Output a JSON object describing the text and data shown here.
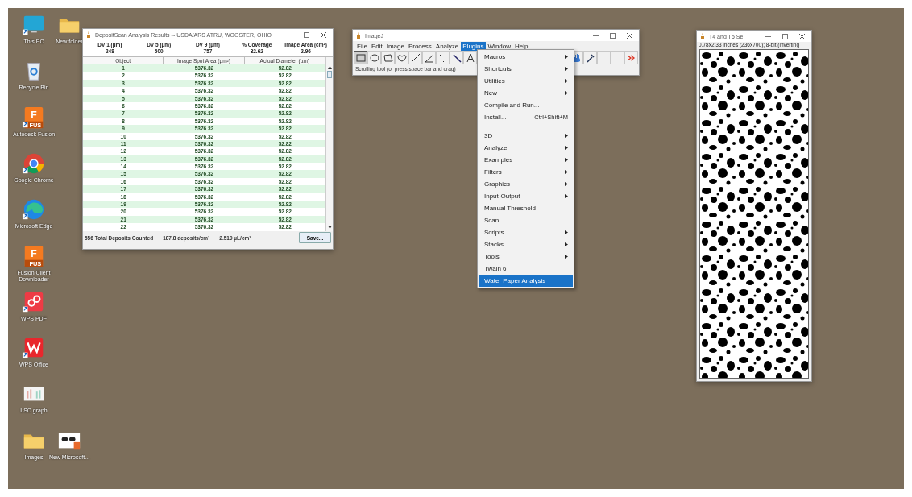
{
  "desktop_icons": [
    {
      "label": "This PC",
      "kind": "monitor",
      "shortcut": true
    },
    {
      "label": "New folder",
      "kind": "folder",
      "shortcut": false
    },
    {
      "label": "Recycle Bin",
      "kind": "recycle-bin",
      "shortcut": false
    },
    {
      "label": "Autodesk Fusion",
      "kind": "fusion",
      "glyph": "F",
      "badge": "FUS",
      "shortcut": true
    },
    {
      "label": "Google Chrome",
      "kind": "chrome",
      "shortcut": true
    },
    {
      "label": "Microsoft Edge",
      "kind": "edge",
      "shortcut": true
    },
    {
      "label": "Fusion Client Downloader",
      "kind": "fusion",
      "glyph": "F",
      "badge": "FUS",
      "shortcut": false
    },
    {
      "label": "WPS PDF",
      "kind": "wps-pdf",
      "shortcut": true
    },
    {
      "label": "WPS Office",
      "kind": "wps-office",
      "shortcut": true
    },
    {
      "label": "LSC graph",
      "kind": "graph",
      "shortcut": false
    },
    {
      "label": "Images",
      "kind": "folder",
      "shortcut": false
    },
    {
      "label": "New Microsoft...",
      "kind": "document",
      "shortcut": false
    }
  ],
  "results_window": {
    "title": "DepositScan Analysis Results -- USDA/ARS ATRU, WOOSTER, OHIO",
    "stats": [
      {
        "label": "DV 1 (µm)",
        "value": "248"
      },
      {
        "label": "DV 5 (µm)",
        "value": "500"
      },
      {
        "label": "DV 9 (µm)",
        "value": "757"
      },
      {
        "label": "% Coverage",
        "value": "32.62"
      },
      {
        "label": "Image Area (cm²)",
        "value": "2.96"
      }
    ],
    "table": {
      "columns": [
        "Object",
        "Image Spot Area (µm²)",
        "Actual Diameter (µm)"
      ],
      "rows": [
        [
          "1",
          "5376.32",
          "52.82"
        ],
        [
          "2",
          "5376.32",
          "52.82"
        ],
        [
          "3",
          "5376.32",
          "52.82"
        ],
        [
          "4",
          "5376.32",
          "52.82"
        ],
        [
          "5",
          "5376.32",
          "52.82"
        ],
        [
          "6",
          "5376.32",
          "52.82"
        ],
        [
          "7",
          "5376.32",
          "52.82"
        ],
        [
          "8",
          "5376.32",
          "52.82"
        ],
        [
          "9",
          "5376.32",
          "52.82"
        ],
        [
          "10",
          "5376.32",
          "52.82"
        ],
        [
          "11",
          "5376.32",
          "52.82"
        ],
        [
          "12",
          "5376.32",
          "52.82"
        ],
        [
          "13",
          "5376.32",
          "52.82"
        ],
        [
          "14",
          "5376.32",
          "52.82"
        ],
        [
          "15",
          "5376.32",
          "52.82"
        ],
        [
          "16",
          "5376.32",
          "52.82"
        ],
        [
          "17",
          "5376.32",
          "52.82"
        ],
        [
          "18",
          "5376.32",
          "52.82"
        ],
        [
          "19",
          "5376.32",
          "52.82"
        ],
        [
          "20",
          "5376.32",
          "52.82"
        ],
        [
          "21",
          "5376.32",
          "52.82"
        ],
        [
          "22",
          "5376.32",
          "52.82"
        ]
      ]
    },
    "footer": [
      "556 Total Deposits Counted",
      "187.8 deposits/cm²",
      "2.519 µL/cm²"
    ],
    "save_button": "Save..."
  },
  "imagej_window": {
    "title": "ImageJ",
    "menu": [
      {
        "label": "File",
        "selected": false
      },
      {
        "label": "Edit",
        "selected": false
      },
      {
        "label": "Image",
        "selected": false
      },
      {
        "label": "Process",
        "selected": false
      },
      {
        "label": "Analyze",
        "selected": false
      },
      {
        "label": "Plugins",
        "selected": true
      },
      {
        "label": "Window",
        "selected": false
      },
      {
        "label": "Help",
        "selected": false
      }
    ],
    "tools": [
      {
        "kind": "rectangle",
        "selected": true
      },
      {
        "kind": "oval",
        "selected": false
      },
      {
        "kind": "polygon",
        "selected": false
      },
      {
        "kind": "freehand",
        "selected": false
      },
      {
        "kind": "line",
        "selected": false
      },
      {
        "kind": "angle",
        "selected": false
      },
      {
        "kind": "point",
        "selected": false
      },
      {
        "kind": "wand",
        "selected": false
      },
      {
        "kind": "text",
        "selected": false
      }
    ],
    "right_tools": [
      {
        "kind": "hand",
        "selected": false
      },
      {
        "kind": "dropper",
        "selected": false
      },
      {
        "kind": "blank",
        "selected": false
      },
      {
        "kind": "blank",
        "selected": false
      },
      {
        "kind": "more",
        "selected": false
      }
    ],
    "status": "Scrolling tool (or press space bar and drag)"
  },
  "plugins_menu": [
    {
      "label": "Macros",
      "submenu": true
    },
    {
      "label": "Shortcuts",
      "submenu": true
    },
    {
      "label": "Utilities",
      "submenu": true
    },
    {
      "label": "New",
      "submenu": true
    },
    {
      "label": "Compile and Run...",
      "submenu": false
    },
    {
      "label": "Install...",
      "shortcut": "Ctrl+Shift+M",
      "submenu": false,
      "separator_after": true
    },
    {
      "label": "3D",
      "submenu": true
    },
    {
      "label": "Analyze",
      "submenu": true
    },
    {
      "label": "Examples",
      "submenu": true
    },
    {
      "label": "Filters",
      "submenu": true
    },
    {
      "label": "Graphics",
      "submenu": true
    },
    {
      "label": "Input-Output",
      "submenu": true
    },
    {
      "label": "Manual Threshold",
      "submenu": false
    },
    {
      "label": "Scan",
      "submenu": false
    },
    {
      "label": "Scripts",
      "submenu": true
    },
    {
      "label": "Stacks",
      "submenu": true
    },
    {
      "label": "Tools",
      "submenu": true
    },
    {
      "label": "Twain 6",
      "submenu": false
    },
    {
      "label": "Water Paper Analysis",
      "submenu": false,
      "selected": true
    }
  ],
  "image_window": {
    "title": "T4 and T5 Se",
    "info": "0.78x2.33 inches (236x700); 8-bit (inverting"
  }
}
